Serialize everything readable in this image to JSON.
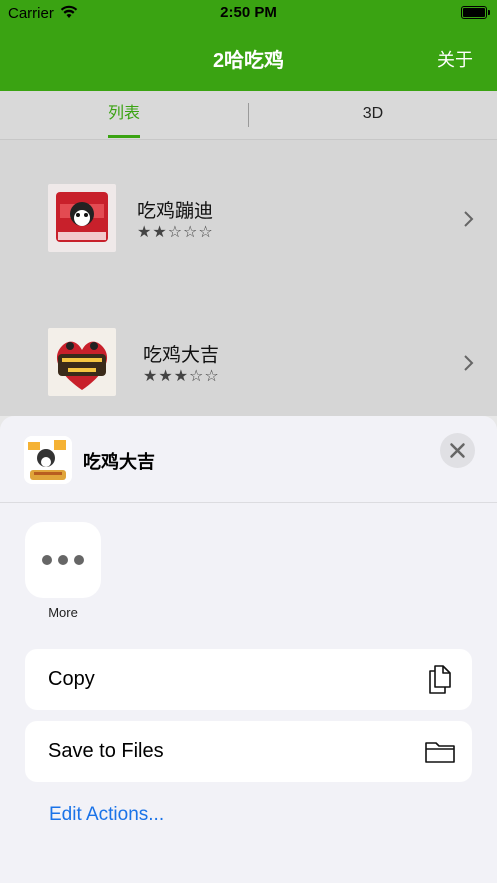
{
  "status": {
    "carrier": "Carrier",
    "time": "2:50 PM"
  },
  "nav": {
    "title": "2哈吃鸡",
    "right": "关于"
  },
  "tabs": [
    {
      "label": "列表",
      "selected": true
    },
    {
      "label": "3D",
      "selected": false
    }
  ],
  "list": [
    {
      "title": "吃鸡蹦迪",
      "stars": "★★☆☆☆",
      "rating": 2
    },
    {
      "title": "吃鸡大吉",
      "stars": "★★★☆☆",
      "rating": 3
    }
  ],
  "sheet": {
    "title": "吃鸡大吉",
    "more_label": "More",
    "actions": [
      {
        "label": "Copy",
        "icon": "copy-icon"
      },
      {
        "label": "Save to Files",
        "icon": "folder-icon"
      }
    ],
    "edit_label": "Edit Actions..."
  },
  "colors": {
    "brand": "#3aa312",
    "link": "#1a73e8"
  }
}
